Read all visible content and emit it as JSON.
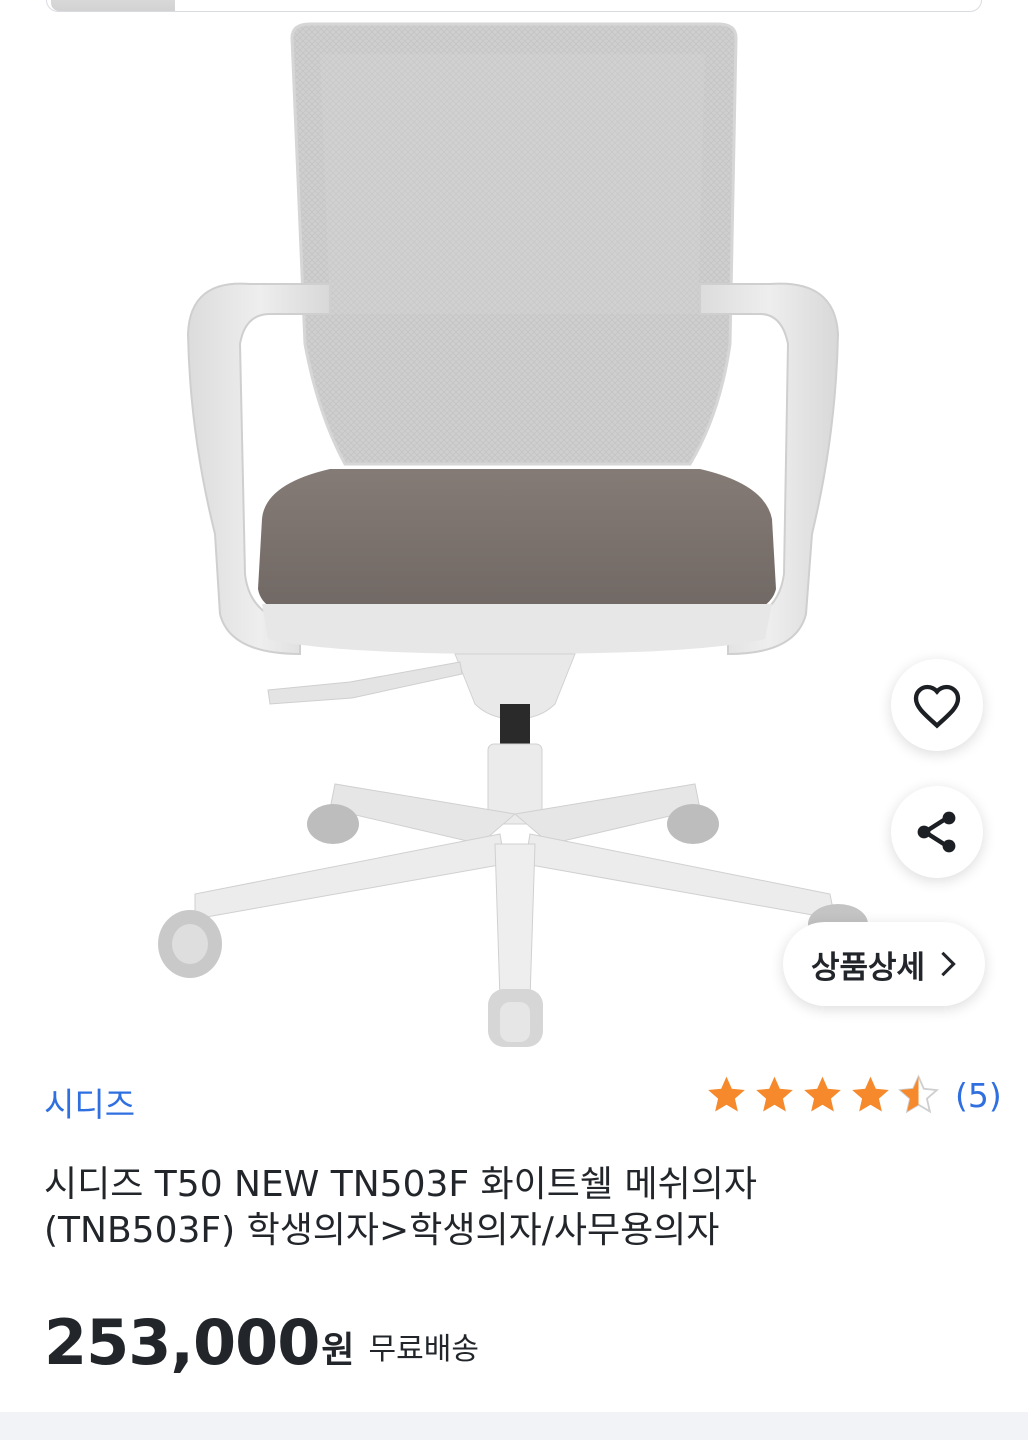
{
  "product": {
    "brand": "시디즈",
    "rating_value": 4.5,
    "rating_count_label": "(5)",
    "title_line1": "시디즈 T50 NEW TN503F 화이트쉘 메쉬의자",
    "title_line2": "(TNB503F) 학생의자>학생의자/사무용의자",
    "price": "253,000",
    "currency": "원",
    "shipping": "무료배송"
  },
  "actions": {
    "detail_label": "상품상세",
    "like_icon": "heart-outline-icon",
    "share_icon": "share-icon"
  },
  "colors": {
    "accent": "#2f6fe0",
    "star": "#f5892b",
    "text": "#22262b"
  }
}
